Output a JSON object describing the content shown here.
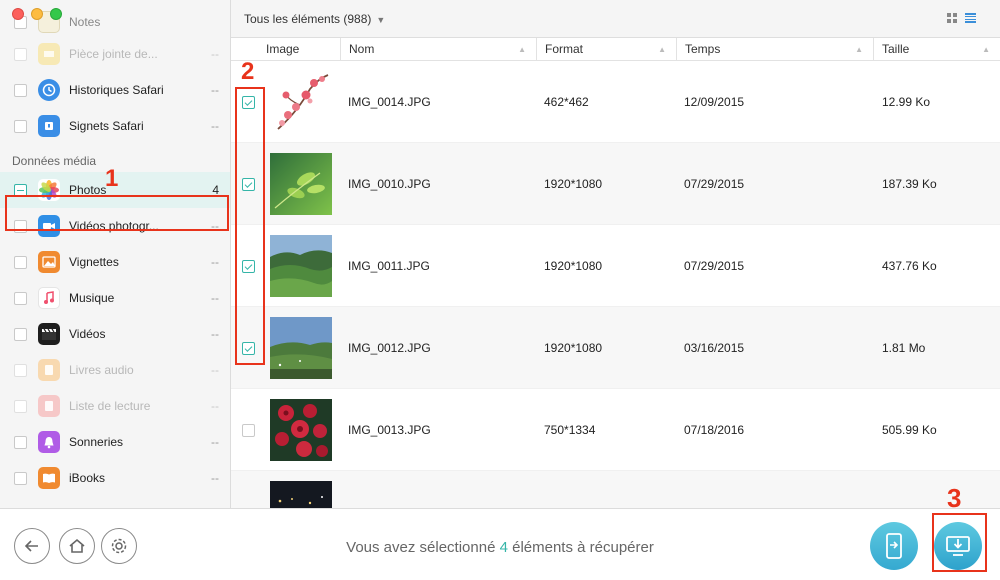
{
  "window": {
    "title": ""
  },
  "sidebar": {
    "items_top": [
      {
        "label": "Notes",
        "count": "",
        "dim": false,
        "icon": "notes-icon",
        "color": "#f2e6b0"
      },
      {
        "label": "Pièce jointe de...",
        "count": "--",
        "dim": true,
        "icon": "attachment-icon",
        "color": "#f3dd92"
      },
      {
        "label": "Historiques Safari",
        "count": "--",
        "dim": false,
        "icon": "safari-history-icon",
        "color": "#3a8ee6"
      },
      {
        "label": "Signets Safari",
        "count": "--",
        "dim": false,
        "icon": "safari-bookmark-icon",
        "color": "#3a8ee6"
      }
    ],
    "section_media": "Données média",
    "items_media": [
      {
        "label": "Photos",
        "count": "4",
        "dim": false,
        "icon": "photos-icon",
        "selected": true
      },
      {
        "label": "Vidéos photogr...",
        "count": "--",
        "dim": false,
        "icon": "video-camera-icon",
        "color": "#2f8fe6"
      },
      {
        "label": "Vignettes",
        "count": "--",
        "dim": false,
        "icon": "thumbnails-icon",
        "color": "#f08a30"
      },
      {
        "label": "Musique",
        "count": "--",
        "dim": false,
        "icon": "music-icon",
        "color": "#ffffff"
      },
      {
        "label": "Vidéos",
        "count": "--",
        "dim": false,
        "icon": "clapper-icon",
        "color": "#222222"
      },
      {
        "label": "Livres audio",
        "count": "--",
        "dim": true,
        "icon": "audiobook-icon",
        "color": "#f6c48a"
      },
      {
        "label": "Liste de lecture",
        "count": "--",
        "dim": true,
        "icon": "playlist-icon",
        "color": "#f3b4b4"
      },
      {
        "label": "Sonneries",
        "count": "--",
        "dim": false,
        "icon": "bell-icon",
        "color": "#b05ce6"
      },
      {
        "label": "iBooks",
        "count": "--",
        "dim": false,
        "icon": "ibooks-icon",
        "color": "#f08a30"
      }
    ]
  },
  "header": {
    "title": "Tous les éléments (988)"
  },
  "table": {
    "columns": [
      "Image",
      "Nom",
      "Format",
      "Temps",
      "Taille"
    ],
    "rows": [
      {
        "name": "IMG_0014.JPG",
        "format": "462*462",
        "time": "12/09/2015",
        "size": "12.99 Ko",
        "checked": true,
        "thumb": "blossom"
      },
      {
        "name": "IMG_0010.JPG",
        "format": "1920*1080",
        "time": "07/29/2015",
        "size": "187.39 Ko",
        "checked": true,
        "thumb": "leaves"
      },
      {
        "name": "IMG_0011.JPG",
        "format": "1920*1080",
        "time": "07/29/2015",
        "size": "437.76 Ko",
        "checked": true,
        "thumb": "hills"
      },
      {
        "name": "IMG_0012.JPG",
        "format": "1920*1080",
        "time": "03/16/2015",
        "size": "1.81 Mo",
        "checked": true,
        "thumb": "landscape"
      },
      {
        "name": "IMG_0013.JPG",
        "format": "750*1334",
        "time": "07/18/2016",
        "size": "505.99 Ko",
        "checked": false,
        "thumb": "roses"
      },
      {
        "name": "",
        "format": "",
        "time": "",
        "size": "",
        "checked": false,
        "thumb": "night"
      }
    ]
  },
  "footer": {
    "status_prefix": "Vous avez sélectionné ",
    "status_count": "4",
    "status_suffix": " éléments à récupérer"
  },
  "annotations": {
    "step1": "1",
    "step2": "2",
    "step3": "3"
  },
  "colors": {
    "accent": "#35b5a8",
    "annotation": "#e8331b",
    "button": "#3fb4d8"
  }
}
